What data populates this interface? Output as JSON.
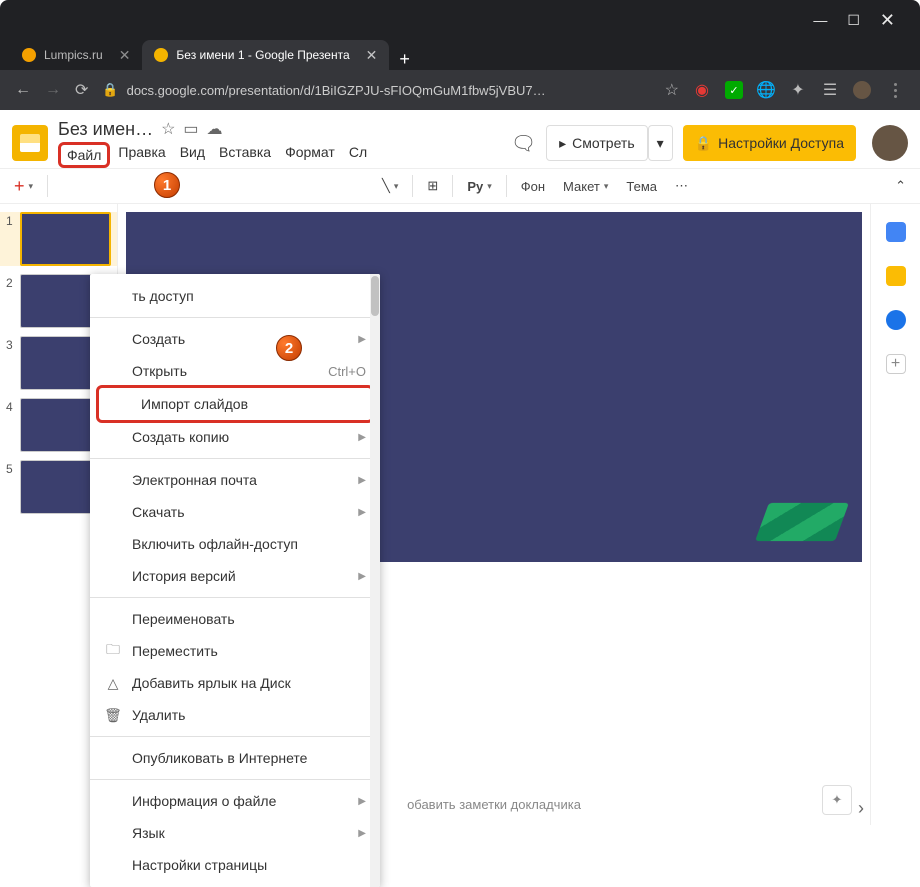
{
  "window": {
    "minimize": "—",
    "maximize": "☐",
    "close": "✕"
  },
  "tabs": [
    {
      "label": "Lumpics.ru",
      "favicon": "#f4a000",
      "active": false
    },
    {
      "label": "Без имени 1 - Google Презента",
      "favicon": "#f4b400",
      "active": true
    }
  ],
  "address": {
    "url": "docs.google.com/presentation/d/1BiIGZPJU-sFIOQmGuM1fbw5jVBU7…"
  },
  "doc": {
    "title": "Без имен…"
  },
  "menubar": {
    "file": "Файл",
    "edit": "Правка",
    "view": "Вид",
    "insert": "Вставка",
    "format": "Формат",
    "slide": "Сл"
  },
  "header_buttons": {
    "present": "Смотреть",
    "share": "Настройки Доступа"
  },
  "toolbar": {
    "py": "Py",
    "bg": "Фон",
    "layout": "Макет",
    "theme": "Тема"
  },
  "thumbs": [
    1,
    2,
    3,
    4,
    5
  ],
  "notes": {
    "placeholder": "обавить заметки докладчика"
  },
  "filemenu": {
    "share": "ть доступ",
    "new": "Создать",
    "open": "Открыть",
    "open_short": "Ctrl+O",
    "import": "Импорт слайдов",
    "copy": "Создать копию",
    "email": "Электронная почта",
    "download": "Скачать",
    "offline": "Включить офлайн-доступ",
    "versions": "История версий",
    "rename": "Переименовать",
    "move": "Переместить",
    "adddrive": "Добавить ярлык на Диск",
    "delete": "Удалить",
    "publish": "Опубликовать в Интернете",
    "info": "Информация о файле",
    "language": "Язык",
    "page_setup": "Настройки страницы"
  },
  "markers": {
    "m1": "1",
    "m2": "2"
  }
}
